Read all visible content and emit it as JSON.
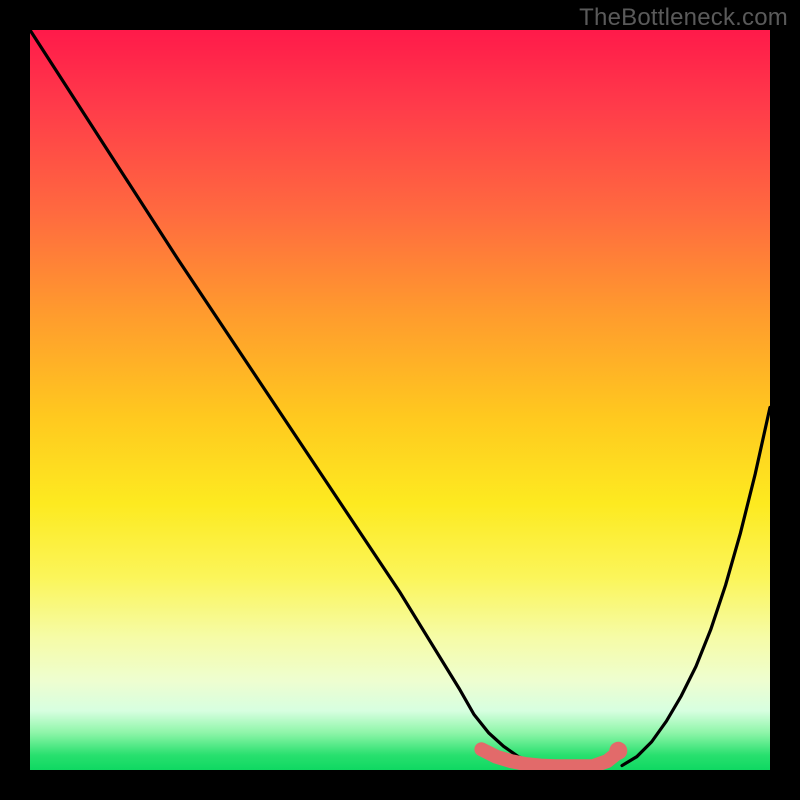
{
  "watermark": "TheBottleneck.com",
  "colors": {
    "curve_stroke": "#000000",
    "accent_stroke": "#e26a6a",
    "accent_fill": "#e26a6a",
    "background": "#000000",
    "gradient_top": "#ff1a4a",
    "gradient_bottom": "#0fd862"
  },
  "chart_data": {
    "type": "line",
    "title": "",
    "xlabel": "",
    "ylabel": "",
    "x_range": [
      0,
      100
    ],
    "y_range": [
      0,
      100
    ],
    "grid": false,
    "legend": false,
    "series": [
      {
        "name": "left-curve",
        "x": [
          0,
          10,
          20,
          30,
          40,
          50,
          58,
          60,
          62,
          64,
          66,
          68,
          70,
          72
        ],
        "y": [
          100,
          84.5,
          69,
          54,
          39,
          24,
          11,
          7.5,
          5,
          3.2,
          1.8,
          1,
          0.5,
          0.3
        ]
      },
      {
        "name": "right-curve",
        "x": [
          80,
          82,
          84,
          86,
          88,
          90,
          92,
          94,
          96,
          98,
          100
        ],
        "y": [
          0.6,
          1.8,
          3.8,
          6.6,
          10,
          14,
          19,
          25,
          32,
          40,
          49
        ]
      },
      {
        "name": "accent-segment",
        "x": [
          61,
          63,
          65,
          67,
          69,
          71,
          73,
          74,
          76,
          78,
          79.5
        ],
        "y": [
          2.8,
          1.8,
          1.2,
          0.8,
          0.6,
          0.5,
          0.5,
          0.5,
          0.5,
          1.2,
          2.4
        ]
      }
    ],
    "markers": [
      {
        "name": "accent-dot",
        "x": 79.5,
        "y": 2.6,
        "r": 1.4
      }
    ]
  }
}
